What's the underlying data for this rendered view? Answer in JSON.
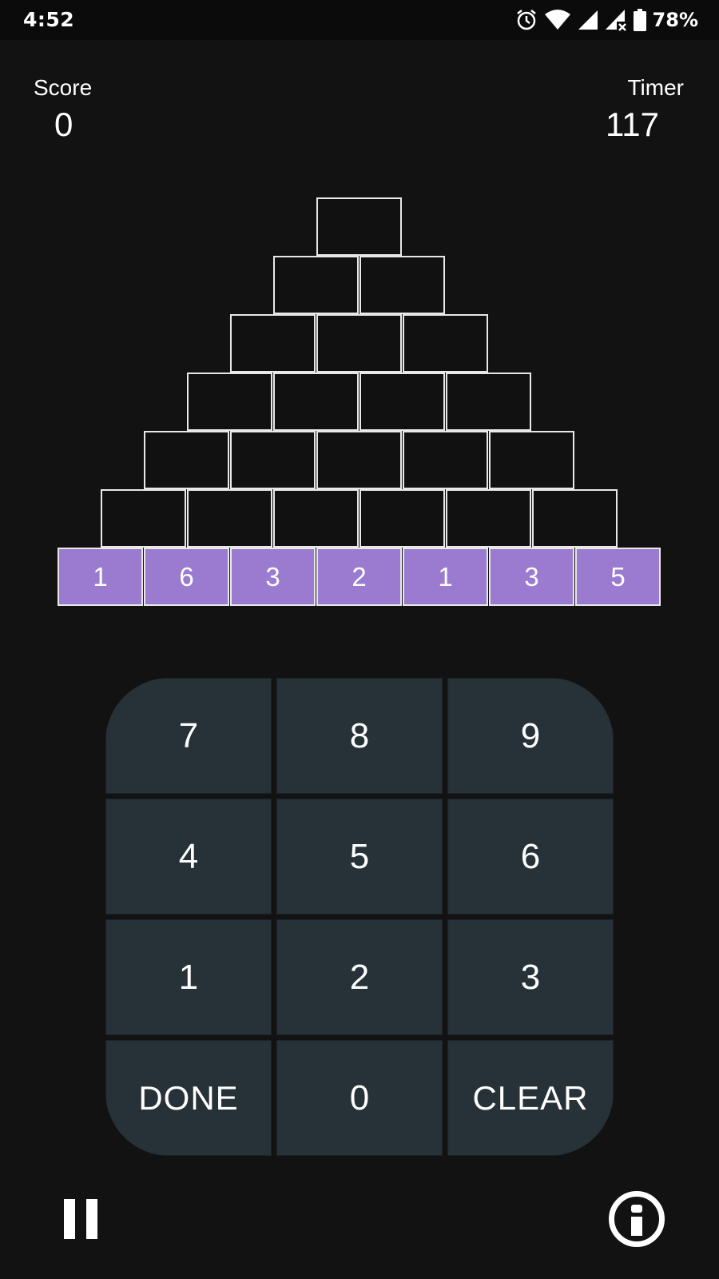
{
  "status_bar": {
    "time": "4:52",
    "icons": [
      "alarm-icon",
      "wifi-icon",
      "signal-icon",
      "signal-no-service-icon",
      "battery-icon"
    ],
    "battery": "78%"
  },
  "score": {
    "label": "Score",
    "value": "0"
  },
  "timer": {
    "label": "Timer",
    "value": "117"
  },
  "pyramid": {
    "rows": 7,
    "base_values": [
      "1",
      "6",
      "3",
      "2",
      "1",
      "3",
      "5"
    ],
    "base_color": "#9b7bd0",
    "empty_color": "#111111",
    "border_color": "#e8e8e8"
  },
  "keypad": {
    "keys": [
      "7",
      "8",
      "9",
      "4",
      "5",
      "6",
      "1",
      "2",
      "3",
      "DONE",
      "0",
      "CLEAR"
    ],
    "key_color": "#263238"
  },
  "controls": {
    "pause": "pause-icon",
    "info": "info-icon"
  }
}
